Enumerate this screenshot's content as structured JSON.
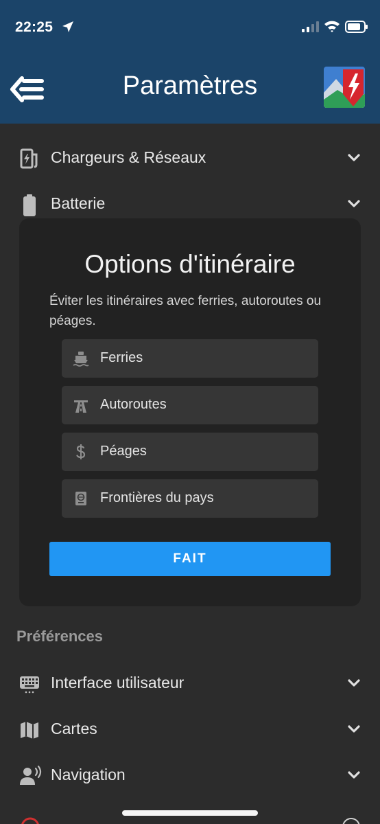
{
  "status_bar": {
    "time": "22:25",
    "icons": [
      "location-arrow-icon",
      "signal-icon",
      "wifi-icon",
      "battery-icon"
    ]
  },
  "header": {
    "title": "Paramètres",
    "back_icon": "menu-back-icon",
    "logo_icon": "app-logo"
  },
  "settings": {
    "rows_top": [
      {
        "label": "Chargeurs & Réseaux",
        "icon": "charging-station-icon"
      },
      {
        "label": "Batterie",
        "icon": "battery-full-icon"
      }
    ],
    "preferences_title": "Préférences",
    "rows_bottom": [
      {
        "label": "Interface utilisateur",
        "icon": "keyboard-icon"
      },
      {
        "label": "Cartes",
        "icon": "map-icon"
      },
      {
        "label": "Navigation",
        "icon": "voice-navigation-icon"
      }
    ]
  },
  "dialog": {
    "title": "Options d'itinéraire",
    "description": "Éviter les itinéraires avec ferries, autoroutes ou péages.",
    "options": [
      {
        "label": "Ferries",
        "icon": "ferry-icon"
      },
      {
        "label": "Autoroutes",
        "icon": "highway-icon"
      },
      {
        "label": "Péages",
        "icon": "dollar-icon"
      },
      {
        "label": "Frontières du pays",
        "icon": "passport-icon"
      }
    ],
    "done_label": "FAIT"
  },
  "colors": {
    "header_bg": "#1b4469",
    "background": "#2c2c2c",
    "dialog_bg": "#222222",
    "option_bg": "#363636",
    "accent": "#2196f3"
  }
}
